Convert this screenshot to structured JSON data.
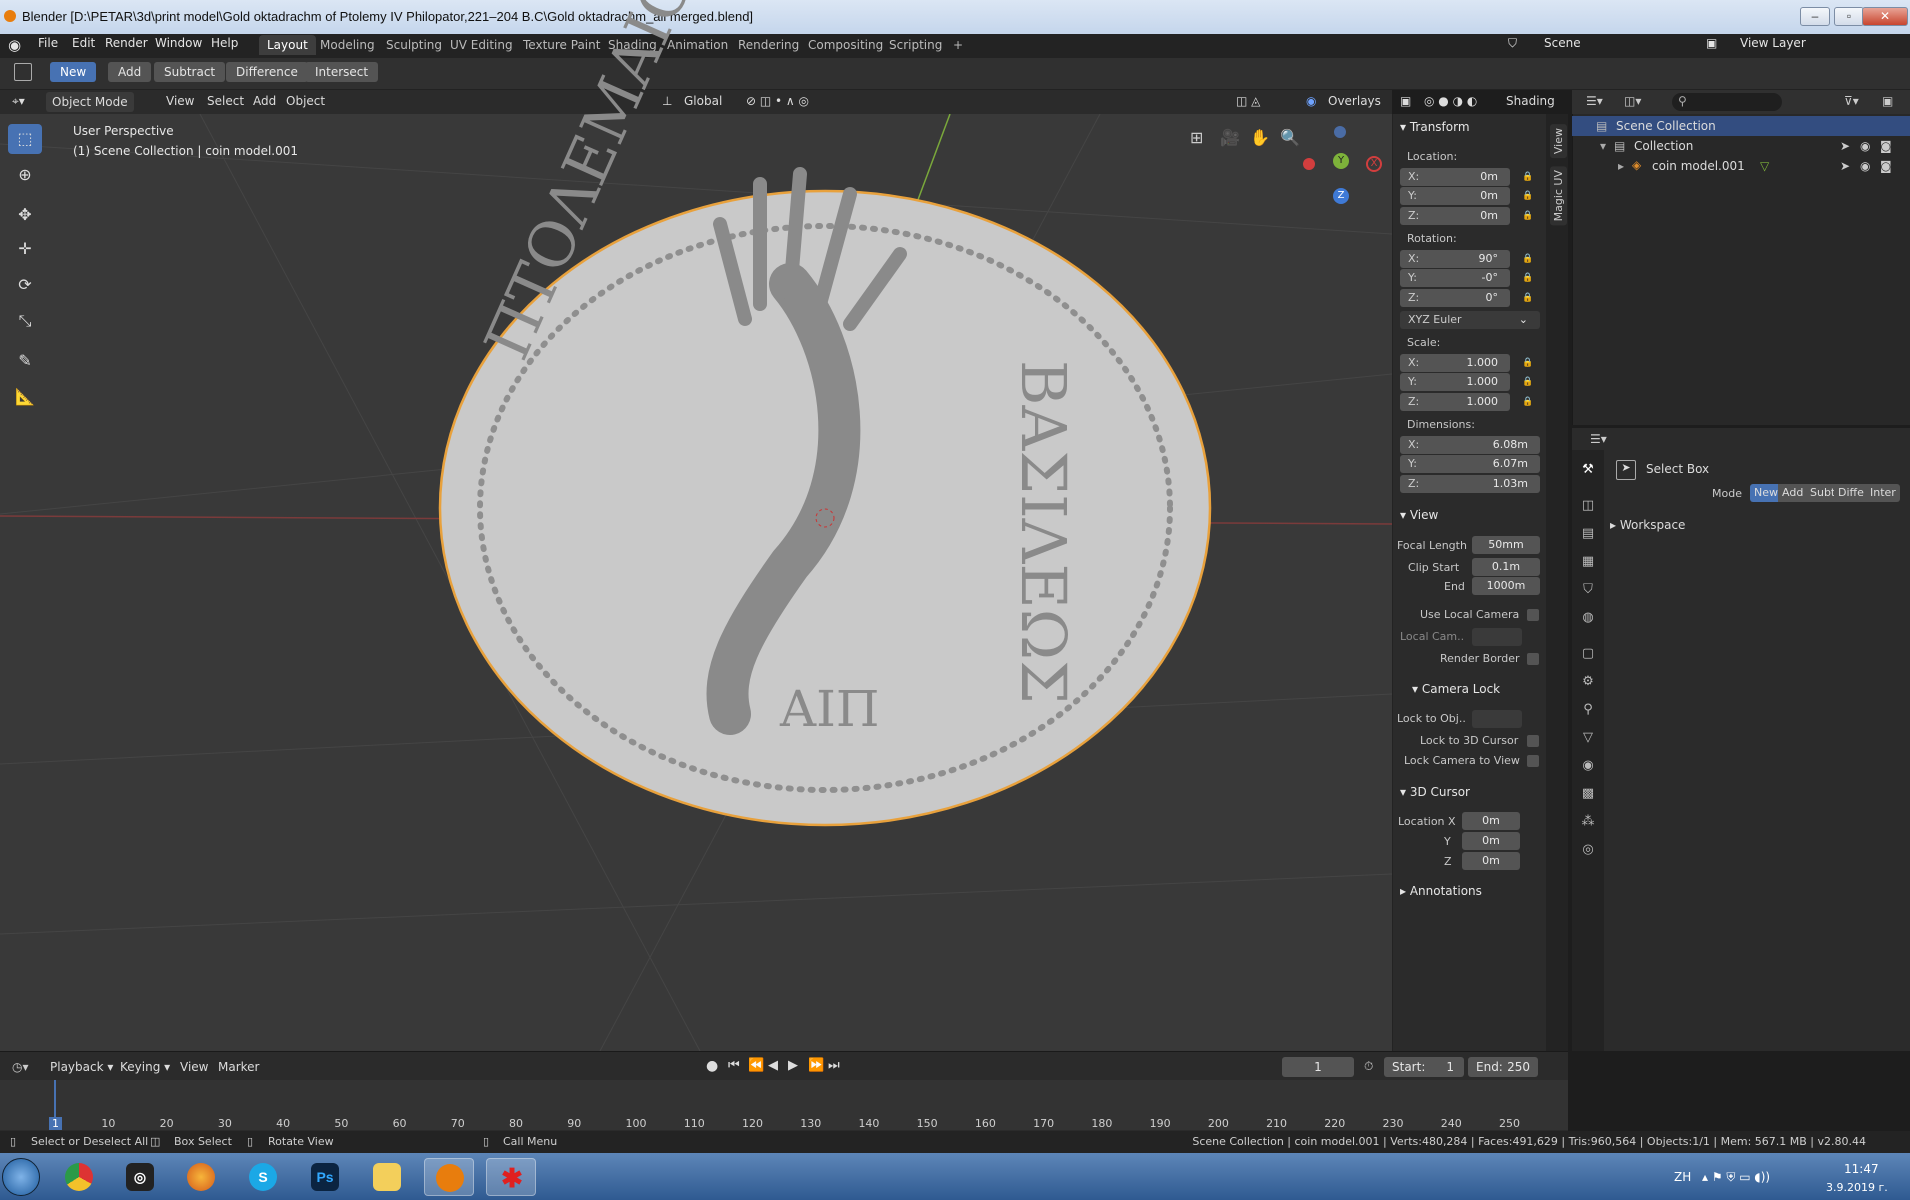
{
  "window": {
    "title": "Blender [D:\\PETAR\\3d\\print model\\Gold oktadrachm of Ptolemy IV Philopator,221–204 B.C\\Gold oktadrachm_all merged.blend]"
  },
  "menu": [
    "File",
    "Edit",
    "Render",
    "Window",
    "Help"
  ],
  "workspaces": [
    "Layout",
    "Modeling",
    "Sculpting",
    "UV Editing",
    "Texture Paint",
    "Shading",
    "Animation",
    "Rendering",
    "Compositing",
    "Scripting"
  ],
  "add_tab": "+",
  "scene": {
    "name": "Scene",
    "view_layer": "View Layer"
  },
  "modebar": [
    "New",
    "Add",
    "Subtract",
    "Difference",
    "Intersect"
  ],
  "viewport_header": {
    "mode": "Object Mode",
    "menus": [
      "View",
      "Select",
      "Add",
      "Object"
    ],
    "orientation": "Global",
    "overlays": "Overlays",
    "shading": "Shading"
  },
  "viewport": {
    "perspective": "User Perspective",
    "collection_info": "(1) Scene Collection | coin model.001",
    "coin_inscription_left": "ΠΤΟΛΕΜΑΙΟΥ",
    "coin_inscription_right": "ΒΑΣΙΛΕΩΣ",
    "coin_center": "ΑΙΠ"
  },
  "npanel": {
    "transform": "Transform",
    "location_label": "Location:",
    "location": [
      {
        "axis": "X:",
        "value": "0m"
      },
      {
        "axis": "Y:",
        "value": "0m"
      },
      {
        "axis": "Z:",
        "value": "0m"
      }
    ],
    "rotation_label": "Rotation:",
    "rotation": [
      {
        "axis": "X:",
        "value": "90°"
      },
      {
        "axis": "Y:",
        "value": "-0°"
      },
      {
        "axis": "Z:",
        "value": "0°"
      }
    ],
    "rotation_mode": "XYZ Euler",
    "scale_label": "Scale:",
    "scale": [
      {
        "axis": "X:",
        "value": "1.000"
      },
      {
        "axis": "Y:",
        "value": "1.000"
      },
      {
        "axis": "Z:",
        "value": "1.000"
      }
    ],
    "dimensions_label": "Dimensions:",
    "dimensions": [
      {
        "axis": "X:",
        "value": "6.08m"
      },
      {
        "axis": "Y:",
        "value": "6.07m"
      },
      {
        "axis": "Z:",
        "value": "1.03m"
      }
    ],
    "view": "View",
    "focal_length_label": "Focal Length",
    "focal_length": "50mm",
    "clip_start_label": "Clip Start",
    "clip_start": "0.1m",
    "clip_end_label": "End",
    "clip_end": "1000m",
    "use_local_camera": "Use Local Camera",
    "local_camera": "Local Cam..",
    "render_border": "Render Border",
    "camera_lock": "Camera Lock",
    "lock_to_obj": "Lock to Obj..",
    "lock_to_cursor": "Lock to 3D Cursor",
    "lock_camera_to_view": "Lock Camera to View",
    "cursor_title": "3D Cursor",
    "cursor": [
      {
        "axis": "Location X",
        "value": "0m"
      },
      {
        "axis": "Y",
        "value": "0m"
      },
      {
        "axis": "Z",
        "value": "0m"
      }
    ],
    "annotations": "Annotations",
    "side_tabs": [
      "View",
      "Magic UV"
    ]
  },
  "outliner": {
    "rows": [
      "Scene Collection",
      "Collection",
      "coin model.001"
    ]
  },
  "properties": {
    "tool": "Select Box",
    "mode_label": "Mode",
    "modes": [
      "New",
      "Add",
      "Subt",
      "Diffe",
      "Inter"
    ],
    "workspace": "Workspace"
  },
  "timeline": {
    "menus": [
      "Playback",
      "Keying",
      "View",
      "Marker"
    ],
    "current_frame": "1",
    "start_label": "Start:",
    "start": "1",
    "end_label": "End:",
    "end": "250",
    "ticks": [
      "1",
      "10",
      "20",
      "30",
      "40",
      "50",
      "60",
      "70",
      "80",
      "90",
      "100",
      "110",
      "120",
      "130",
      "140",
      "150",
      "160",
      "170",
      "180",
      "190",
      "200",
      "210",
      "220",
      "230",
      "240",
      "250"
    ]
  },
  "statusbar": {
    "hint1": "Select or Deselect All",
    "hint2": "Box Select",
    "hint3": "Rotate View",
    "hint4": "Call Menu",
    "stats": "Scene Collection | coin model.001 | Verts:480,284 | Faces:491,629 | Tris:960,564 | Objects:1/1 | Mem: 567.1 MB | v2.80.44"
  },
  "taskbar": {
    "lang": "ZH",
    "time": "11:47",
    "date": "3.9.2019 г."
  },
  "colors": {
    "accent": "#4772b3",
    "selection_outline": "#e8a13c",
    "taskbar": "#3b679e"
  }
}
